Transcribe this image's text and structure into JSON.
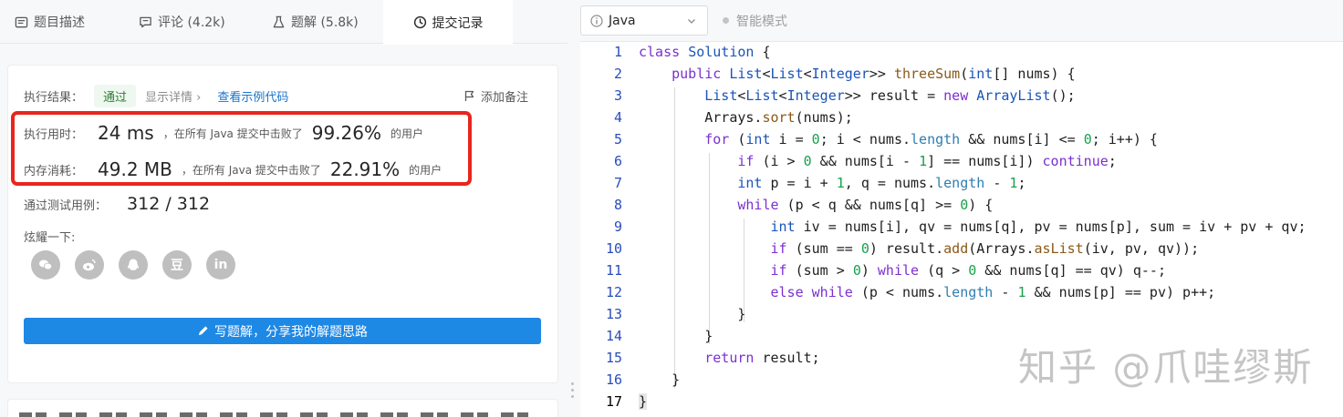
{
  "tabs": [
    {
      "label": "题目描述",
      "icon": "document-icon"
    },
    {
      "label": "评论 (4.2k)",
      "icon": "comment-icon"
    },
    {
      "label": "题解 (5.8k)",
      "icon": "flask-icon"
    },
    {
      "label": "提交记录",
      "icon": "clock-icon",
      "active": true
    }
  ],
  "result": {
    "label": "执行结果：",
    "status": "通过",
    "details_link": "显示详情 ›",
    "sample_link": "查看示例代码",
    "add_note": "添加备注"
  },
  "runtime": {
    "label": "执行用时：",
    "value": "24 ms",
    "beat_prefix": "，在所有 Java 提交中击败了",
    "percent": "99.26%",
    "beat_suffix": "的用户"
  },
  "memory": {
    "label": "内存消耗：",
    "value": "49.2 MB",
    "beat_prefix": "，在所有 Java 提交中击败了",
    "percent": "22.91%",
    "beat_suffix": "的用户"
  },
  "testcases": {
    "label": "通过测试用例：",
    "value": "312 / 312"
  },
  "share": {
    "label": "炫耀一下:",
    "icons": [
      "wechat-icon",
      "weibo-icon",
      "qq-icon",
      "douban-icon",
      "linkedin-icon"
    ],
    "douban_glyph": "豆",
    "linkedin_glyph": "in"
  },
  "write_button": "写题解，分享我的解题思路",
  "editor": {
    "language": "Java",
    "smart_mode": "智能模式",
    "line_numbers": [
      "1",
      "2",
      "3",
      "4",
      "5",
      "6",
      "7",
      "8",
      "9",
      "10",
      "11",
      "12",
      "13",
      "14",
      "15",
      "16",
      "17"
    ],
    "current_line": "17"
  },
  "watermark": "知乎 @爪哇缪斯",
  "colors": {
    "accent": "#1e88e5",
    "highlight_box": "#e8261e",
    "pass_green": "#2e7d32"
  }
}
